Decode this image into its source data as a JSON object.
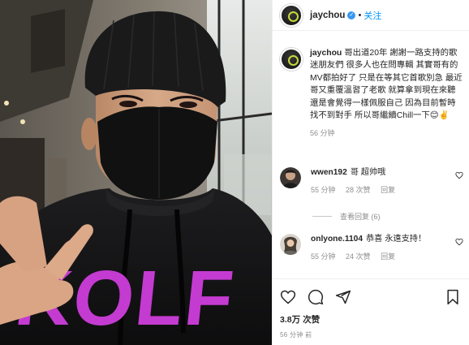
{
  "post": {
    "image_alt": "Man in black beanie, black face mask and black hoodie with purple lettering making a peace sign",
    "hoodie_text": "KOLF"
  },
  "header": {
    "username": "jaychou",
    "separator": "•",
    "follow_label": "关注"
  },
  "caption": {
    "username": "jaychou",
    "text": "哥出道20年 謝謝一路支持的歌迷朋友們 很多人也在問專輯 其實哥有的MV都拍好了 只是在等其它首歌別急 最近哥又重覆溫習了老歌 就算拿到現在來聽 還是會覺得一樣佩服自己 因為目前暫時找不到對手 所以哥繼續Chill一下😊✌️",
    "time": "56 分钟"
  },
  "comments": [
    {
      "username": "wwen192",
      "text": "哥 超帅哦",
      "time": "55 分钟",
      "likes": "28 次赞",
      "reply_label": "回复"
    },
    {
      "username": "onlyone.1104",
      "text": "恭喜 永遠支持！",
      "time": "55 分钟",
      "likes": "24 次赞",
      "reply_label": "回复"
    }
  ],
  "view_replies_label": "查看回复 (6)",
  "stats": {
    "likes_count": "3.8万",
    "likes_label": "次赞"
  },
  "posted_time": "56 分钟 前",
  "colors": {
    "link_blue": "#0095f6",
    "verified_blue": "#3897f0",
    "muted_gray": "#8e8e8e",
    "text": "#262626",
    "hoodie_text": "#c43bd1"
  }
}
